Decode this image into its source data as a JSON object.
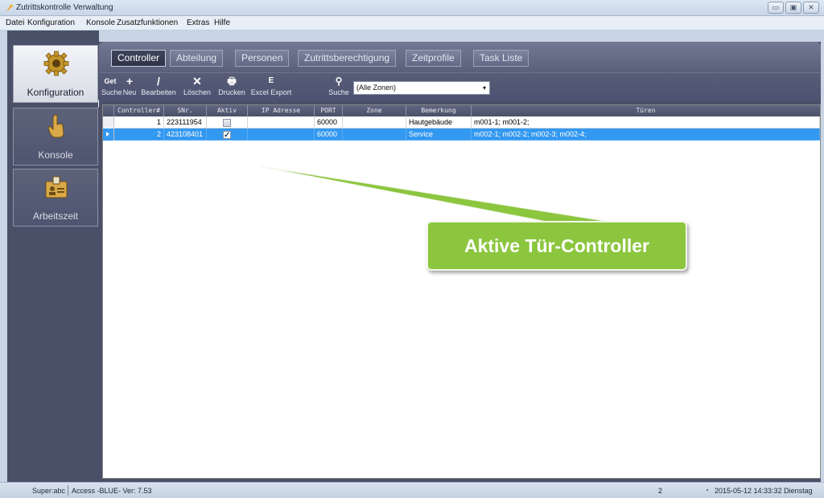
{
  "window": {
    "title": "Zutrittskontrolle Verwaltung",
    "buttons": [
      "▭",
      "▣",
      "✕"
    ]
  },
  "menu": [
    "Datei",
    "Konfiguration",
    "Konsole",
    "Zusatzfunktionen",
    "Extras",
    "Hilfe"
  ],
  "sidebar": {
    "items": [
      {
        "label": "Konfiguration",
        "icon": "gear-icon",
        "active": true
      },
      {
        "label": "Konsole",
        "icon": "hand-pointer-icon",
        "active": false
      },
      {
        "label": "Arbeitszeit",
        "icon": "id-card-icon",
        "active": false
      }
    ]
  },
  "tabs": [
    "Controller",
    "Abteilung",
    "Personen",
    "Zutrittsberechtigung",
    "Zeitprofile",
    "Task Liste"
  ],
  "active_tab": "Controller",
  "toolbar": {
    "items": [
      {
        "icon": "Get",
        "label": "Suche"
      },
      {
        "icon": "+",
        "label": "Neu"
      },
      {
        "icon": "/",
        "label": "Bearbeiten"
      },
      {
        "icon": "✕",
        "label": "Löschen"
      },
      {
        "icon": "🖶",
        "label": "Drucken"
      },
      {
        "icon": "E",
        "label": "Excel Export"
      },
      {
        "icon": "⚲",
        "label": "Suche"
      }
    ],
    "zone_select": "(Alle Zonen)"
  },
  "grid": {
    "columns": [
      "Controller#",
      "SNr.",
      "Aktiv",
      "IP Adresse",
      "PORT",
      "Zone",
      "Bemerkung",
      "Türen"
    ],
    "rows": [
      {
        "controller": "1",
        "snr": "223111954",
        "aktiv": false,
        "ip": "",
        "port": "60000",
        "zone": "",
        "bemerkung": "Hautgebäude",
        "tueren": "m001-1;  m001-2;",
        "selected": false
      },
      {
        "controller": "2",
        "snr": "423108401",
        "aktiv": true,
        "ip": "",
        "port": "60000",
        "zone": "",
        "bemerkung": "Service",
        "tueren": "m002-1;  m002-2;  m002-3;  m002-4;",
        "selected": true
      }
    ]
  },
  "callout": "Aktive Tür-Controller",
  "status": {
    "user": "Super:abc",
    "version": "Access -BLUE- Ver: 7.53",
    "count": "2",
    "datetime": "2015-05-12 14:33:32 Dienstag"
  },
  "colors": {
    "panel": "#4a5068",
    "selected_row": "#3398f0",
    "callout": "#8cc63f"
  }
}
